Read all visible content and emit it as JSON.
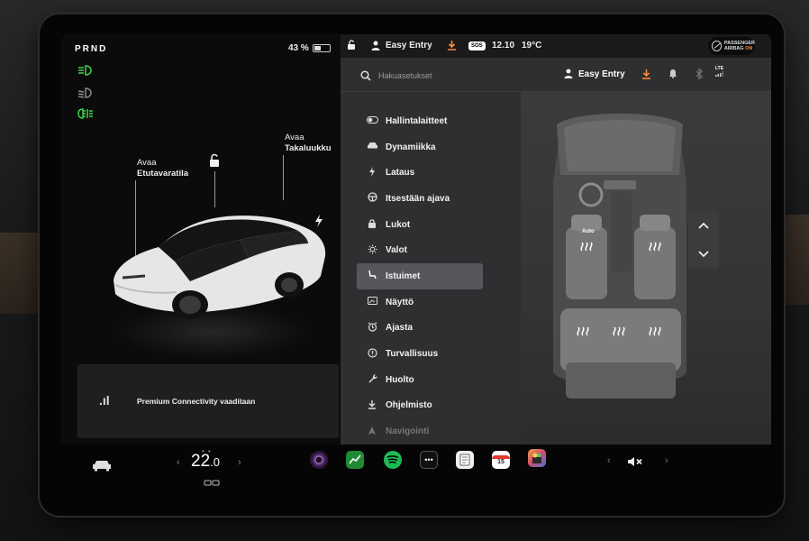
{
  "gear": "PRND",
  "battery": {
    "percent_label": "43 %",
    "level": 0.43
  },
  "left": {
    "frunk_label_line1": "Avaa",
    "frunk_label_line2": "Etutavaratila",
    "trunk_label_line1": "Avaa",
    "trunk_label_line2": "Takaluukku",
    "connectivity_text": "Premium Connectivity vaaditaan"
  },
  "status": {
    "profile": "Easy Entry",
    "time": "12.10",
    "temperature": "19°C",
    "sos": "SOS",
    "airbag_line1": "PASSENGER",
    "airbag_line2": "AIRBAG",
    "airbag_state": "ON"
  },
  "search": {
    "placeholder": "Hakuasetukset",
    "profile": "Easy Entry",
    "lte": "LTE"
  },
  "menu": [
    {
      "label": "Hallintalaitteet",
      "icon": "toggle-icon"
    },
    {
      "label": "Dynamiikka",
      "icon": "car-icon"
    },
    {
      "label": "Lataus",
      "icon": "bolt-icon"
    },
    {
      "label": "Itsestään ajava",
      "icon": "steering-wheel-icon"
    },
    {
      "label": "Lukot",
      "icon": "lock-icon"
    },
    {
      "label": "Valot",
      "icon": "sun-icon"
    },
    {
      "label": "Istuimet",
      "icon": "seat-icon"
    },
    {
      "label": "Näyttö",
      "icon": "display-icon"
    },
    {
      "label": "Ajasta",
      "icon": "alarm-icon"
    },
    {
      "label": "Turvallisuus",
      "icon": "info-icon"
    },
    {
      "label": "Huolto",
      "icon": "wrench-icon"
    },
    {
      "label": "Ohjelmisto",
      "icon": "download-icon"
    },
    {
      "label": "Navigointi",
      "icon": "navigation-icon"
    }
  ],
  "active_menu": "Istuimet",
  "seat_heater_label": "Auto",
  "bottom": {
    "temp_int": "22",
    "temp_dec": ".0",
    "calendar_day": "15"
  },
  "colors": {
    "accent_orange": "#ff8a3d",
    "lamp_green": "#3ed44a",
    "panel": "#2e2f31"
  }
}
